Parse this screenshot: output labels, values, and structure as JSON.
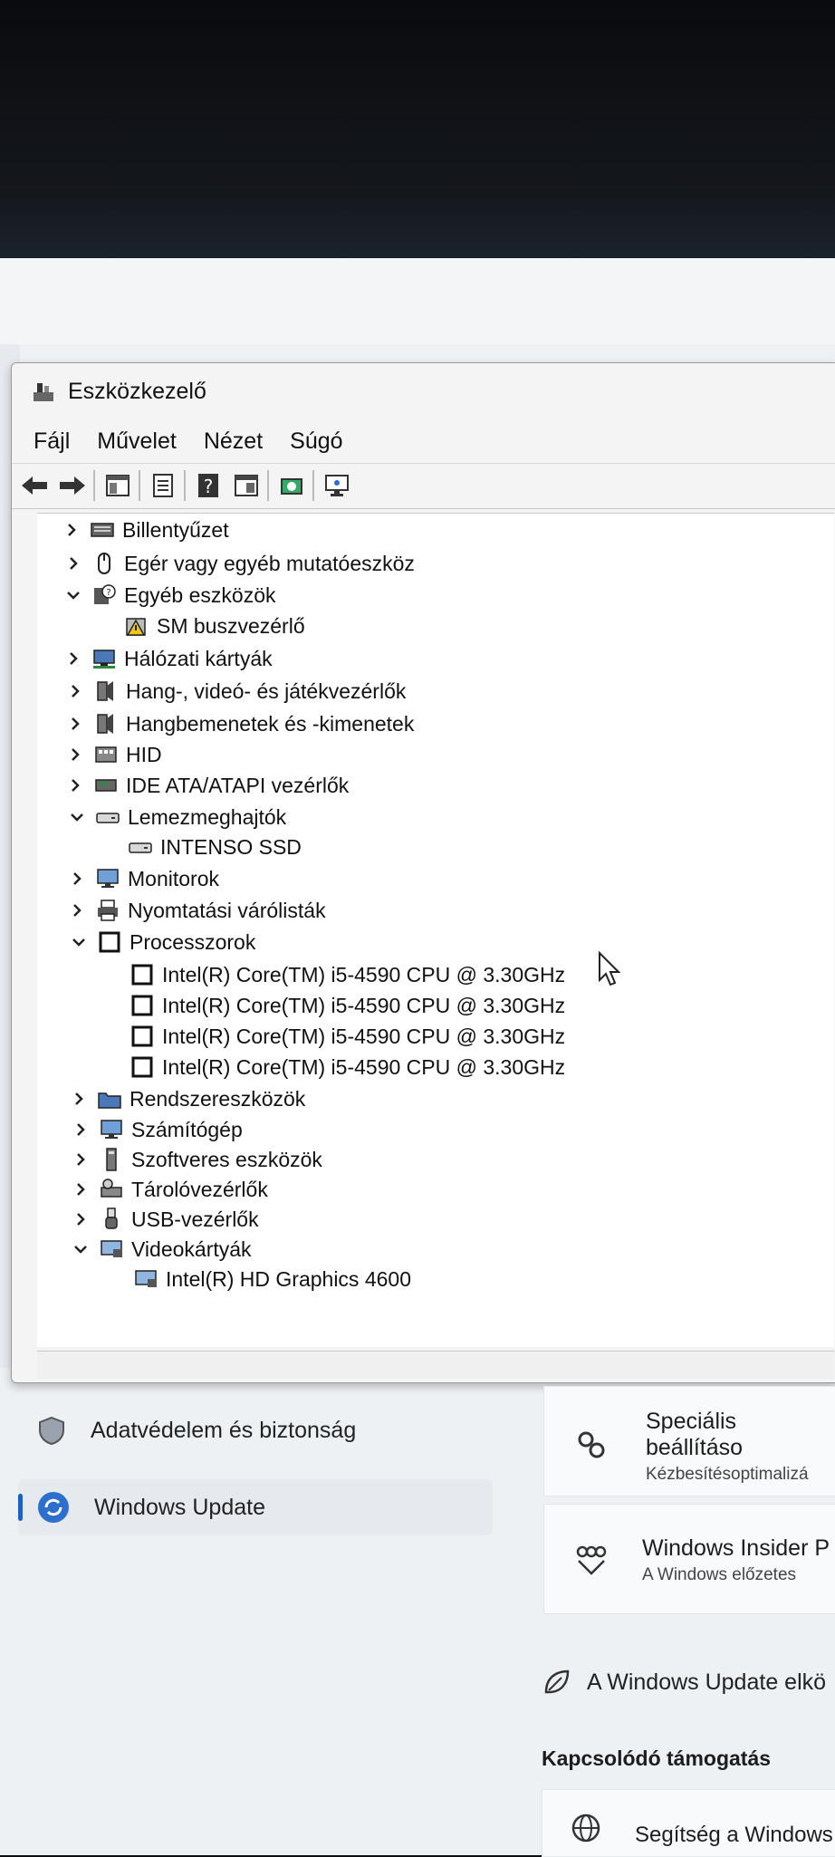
{
  "window": {
    "title": "Eszközkezelő",
    "menu": [
      "Fájl",
      "Művelet",
      "Nézet",
      "Súgó"
    ]
  },
  "tree": [
    {
      "label": "Billentyűzet",
      "expanded": false,
      "icon": "keyboard-icon"
    },
    {
      "label": "Egér vagy egyéb mutatóeszköz",
      "expanded": false,
      "icon": "mouse-icon"
    },
    {
      "label": "Egyéb eszközök",
      "expanded": true,
      "icon": "unknown-device-icon"
    },
    {
      "label": "SM buszvezérlő",
      "child": true,
      "icon": "warning-device-icon"
    },
    {
      "label": "Hálózati kártyák",
      "expanded": false,
      "icon": "network-icon"
    },
    {
      "label": "Hang-, videó- és játékvezérlők",
      "expanded": false,
      "icon": "speaker-icon"
    },
    {
      "label": "Hangbemenetek és -kimenetek",
      "expanded": false,
      "icon": "speaker-icon"
    },
    {
      "label": "HID",
      "expanded": false,
      "icon": "hid-icon"
    },
    {
      "label": "IDE ATA/ATAPI vezérlők",
      "expanded": false,
      "icon": "ide-icon"
    },
    {
      "label": "Lemezmeghajtók",
      "expanded": true,
      "icon": "disk-icon"
    },
    {
      "label": "INTENSO SSD",
      "child": true,
      "icon": "disk-icon"
    },
    {
      "label": "Monitorok",
      "expanded": false,
      "icon": "monitor-icon"
    },
    {
      "label": "Nyomtatási várólisták",
      "expanded": false,
      "icon": "printer-icon"
    },
    {
      "label": "Processzorok",
      "expanded": true,
      "icon": "cpu-icon"
    },
    {
      "label": "Intel(R) Core(TM) i5-4590 CPU @ 3.30GHz",
      "child": true,
      "icon": "cpu-icon"
    },
    {
      "label": "Intel(R) Core(TM) i5-4590 CPU @ 3.30GHz",
      "child": true,
      "icon": "cpu-icon"
    },
    {
      "label": "Intel(R) Core(TM) i5-4590 CPU @ 3.30GHz",
      "child": true,
      "icon": "cpu-icon"
    },
    {
      "label": "Intel(R) Core(TM) i5-4590 CPU @ 3.30GHz",
      "child": true,
      "icon": "cpu-icon"
    },
    {
      "label": "Rendszereszközök",
      "expanded": false,
      "icon": "folder-icon"
    },
    {
      "label": "Számítógép",
      "expanded": false,
      "icon": "monitor-icon"
    },
    {
      "label": "Szoftveres eszközök",
      "expanded": false,
      "icon": "software-device-icon"
    },
    {
      "label": "Tárolóvezérlők",
      "expanded": false,
      "icon": "storage-controller-icon"
    },
    {
      "label": "USB-vezérlők",
      "expanded": false,
      "icon": "usb-icon"
    },
    {
      "label": "Videokártyák",
      "expanded": true,
      "icon": "display-adapter-icon"
    },
    {
      "label": "Intel(R) HD Graphics 4600",
      "child": true,
      "icon": "display-adapter-icon"
    }
  ],
  "settings": {
    "privacy_label": "Adatvédelem és biztonság",
    "update_label": "Windows Update",
    "card1_title": "Speciális beállításo",
    "card1_sub": "Kézbesítésoptimalizá",
    "card2_title": "Windows Insider P",
    "card2_sub": "A Windows előzetes",
    "eco_text": "A Windows Update elkö",
    "related_heading": "Kapcsolódó támogatás",
    "help_text": "Segítség a Windows"
  }
}
